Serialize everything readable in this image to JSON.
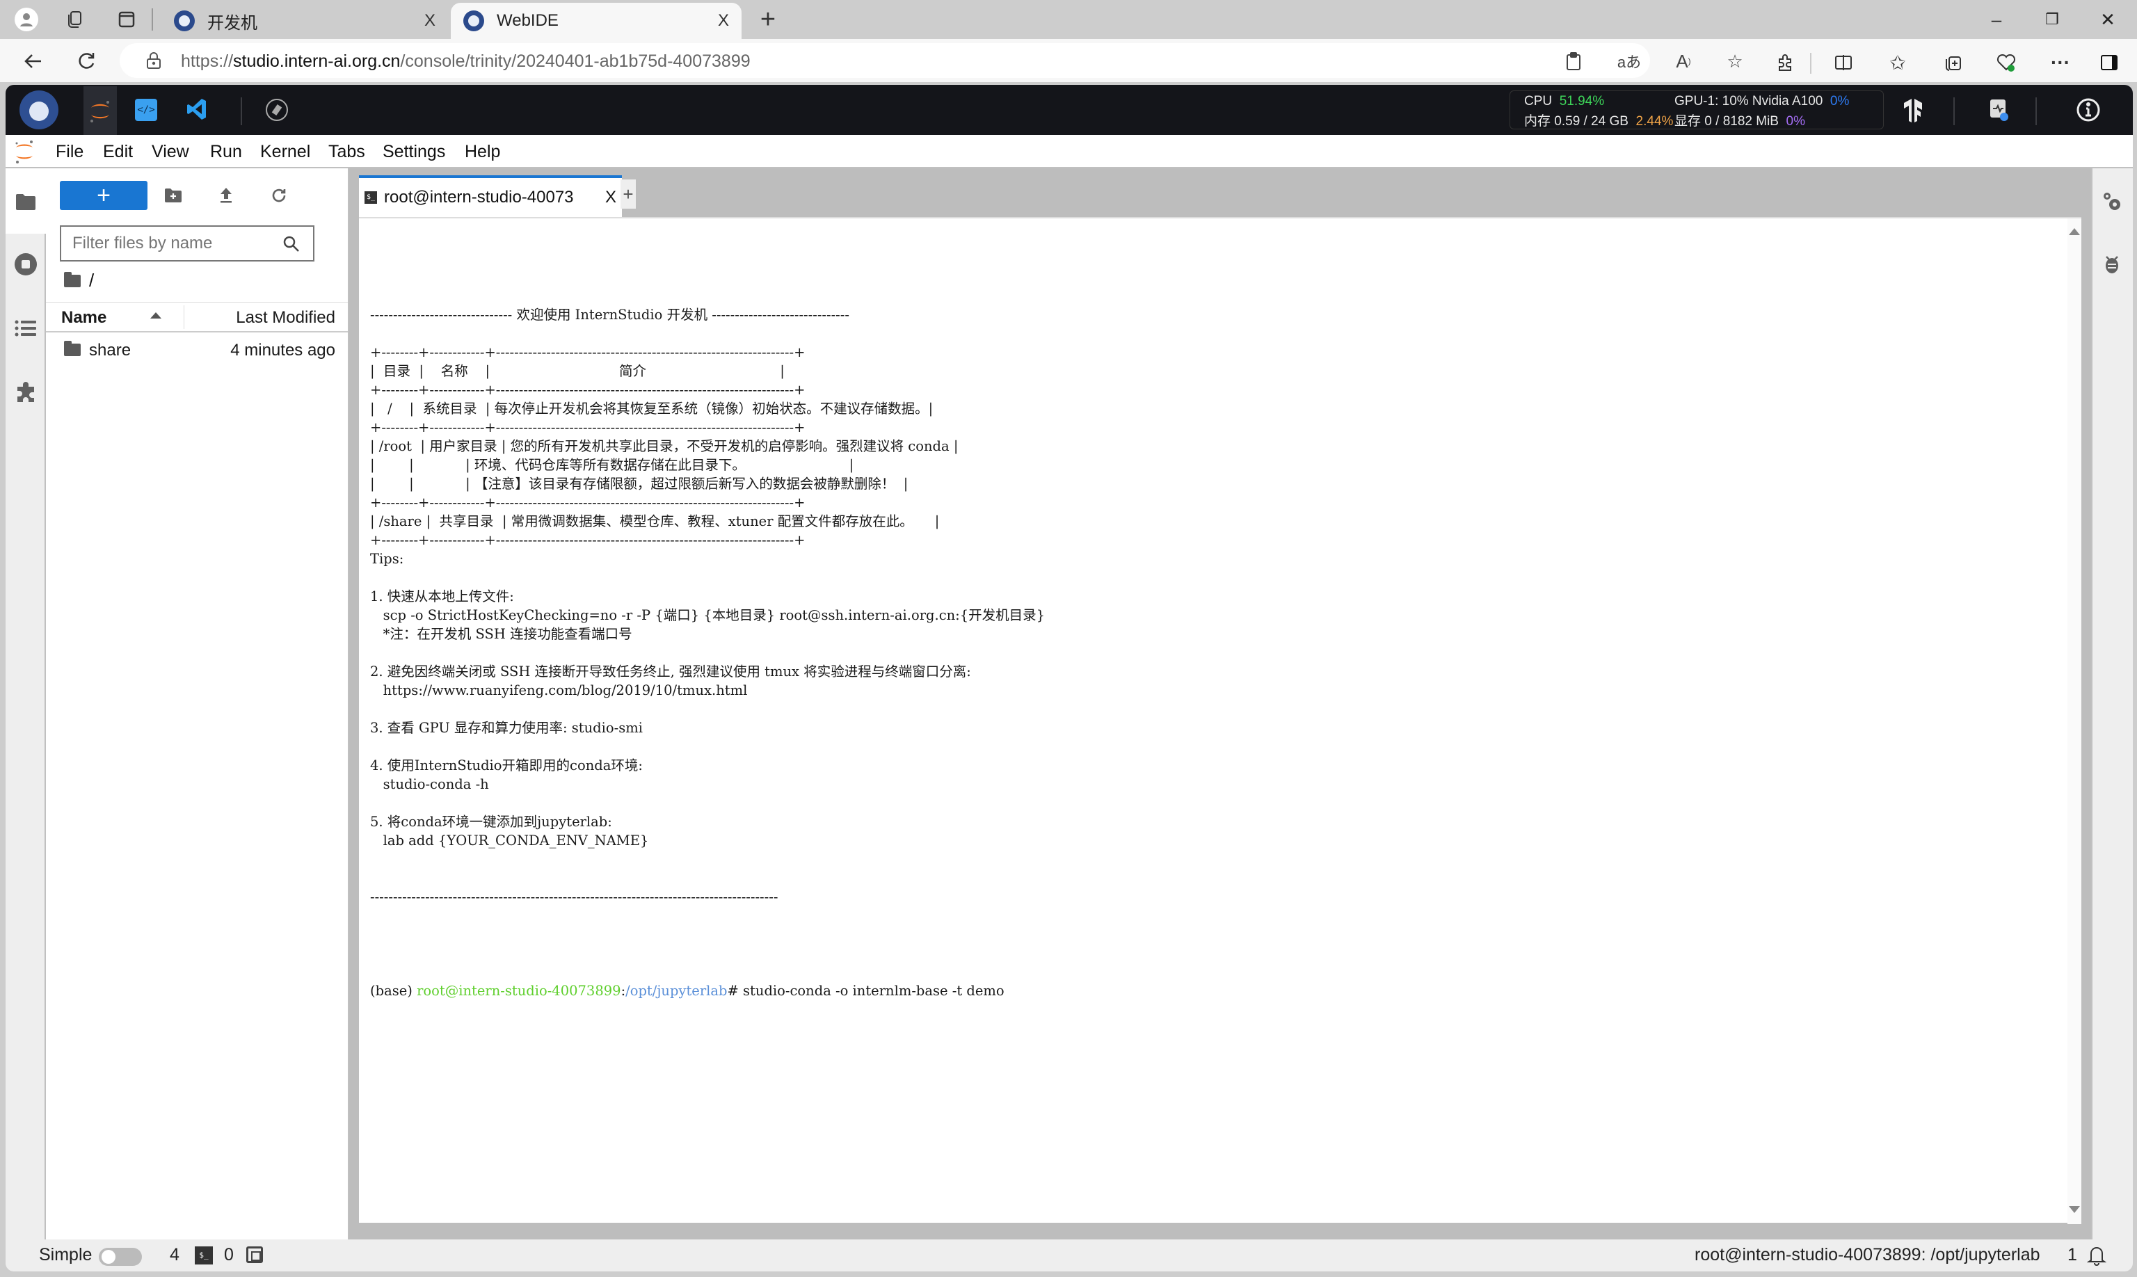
{
  "browser": {
    "tabs": [
      {
        "title": "开发机",
        "active": false
      },
      {
        "title": "WebIDE",
        "active": true
      }
    ],
    "url_host": "studio.intern-ai.org.cn",
    "url_scheme": "https://",
    "url_path": "/console/trinity/20240401-ab1b75d-40073899",
    "icons": {
      "profile": "profile-icon",
      "workspaces": "workspaces-icon",
      "tab_actions": "vertical-tabs-icon",
      "new_tab": "plus-icon",
      "minimize": "minimize-icon",
      "restore": "restore-icon",
      "close": "close-icon"
    },
    "new_tab_label": "+",
    "close_label": "X",
    "min_label": "–",
    "restore_label": "❐",
    "winclose_label": "✕"
  },
  "app_header": {
    "code_label": "</>",
    "vscode_label": "❮",
    "stats": {
      "cpu_label": "CPU",
      "cpu_value": "51.94%",
      "mem_label": "内存",
      "mem_value": "0.59 / 24 GB",
      "mem_pct": "2.44%",
      "gpu_label": "GPU-1: 10% Nvidia A100",
      "gpu_pct": "0%",
      "vram_label": "显存",
      "vram_value": "0 / 8182 MiB",
      "vram_pct": "0%"
    },
    "colors": {
      "cpu": "#3ed65a",
      "mem": "#f0a347",
      "gpu": "#2e7cf5",
      "vram": "#a56ef5"
    }
  },
  "menubar": {
    "items": [
      "File",
      "Edit",
      "View",
      "Run",
      "Kernel",
      "Tabs",
      "Settings",
      "Help"
    ]
  },
  "file_browser": {
    "new_label": "+",
    "filter_placeholder": "Filter files by name",
    "breadcrumb": "/",
    "columns": {
      "name": "Name",
      "modified": "Last Modified"
    },
    "files": [
      {
        "name": "share",
        "type": "folder",
        "modified": "4 minutes ago"
      }
    ]
  },
  "doc_tab": {
    "title": "root@intern-studio-40073",
    "close_label": "X",
    "add_label": "+"
  },
  "terminal": {
    "lines": [
      "",
      "------------------------------- 欢迎使用 InternStudio 开发机 ------------------------------",
      "",
      "+--------+------------+-----------------------------------------------------------------+",
      "|  目录  |    名称    |                              简介                               |",
      "+--------+------------+-----------------------------------------------------------------+",
      "|   /    |  系统目录  | 每次停止开发机会将其恢复至系统（镜像）初始状态。不建议存储数据。|",
      "+--------+------------+-----------------------------------------------------------------+",
      "| /root  | 用户家目录 | 您的所有开发机共享此目录，不受开发机的启停影响。强烈建议将 conda |",
      "|        |            | 环境、代码仓库等所有数据存储在此目录下。                        |",
      "|        |            | 【注意】该目录有存储限额，超过限额后新写入的数据会被静默删除！  |",
      "+--------+------------+-----------------------------------------------------------------+",
      "| /share |  共享目录  | 常用微调数据集、模型仓库、教程、xtuner 配置文件都存放在此。     |",
      "+--------+------------+-----------------------------------------------------------------+",
      "Tips:",
      "",
      "1. 快速从本地上传文件:",
      "   scp -o StrictHostKeyChecking=no -r -P {端口} {本地目录} root@ssh.intern-ai.org.cn:{开发机目录}",
      "   *注：在开发机 SSH 连接功能查看端口号",
      "",
      "2. 避免因终端关闭或 SSH 连接断开导致任务终止, 强烈建议使用 tmux 将实验进程与终端窗口分离:",
      "   https://www.ruanyifeng.com/blog/2019/10/tmux.html",
      "",
      "3. 查看 GPU 显存和算力使用率: studio-smi",
      "",
      "4. 使用InternStudio开箱即用的conda环境:",
      "   studio-conda -h",
      "",
      "5. 将conda环境一键添加到jupyterlab:",
      "   lab add {YOUR_CONDA_ENV_NAME}",
      "",
      "",
      "-----------------------------------------------------------------------------------------",
      "",
      ""
    ],
    "prompt": {
      "env": "(base) ",
      "user_host": "root@intern-studio-40073899",
      "sep": ":",
      "cwd": "/opt/jupyterlab",
      "hash": "# ",
      "command": "studio-conda -o internlm-base -t demo"
    },
    "colors": {
      "user_host": "#5fcf2d",
      "cwd": "#5a8fd8"
    }
  },
  "status_bar": {
    "mode_label": "Simple",
    "simple_mode_on": false,
    "kernels_count": "4",
    "terminals_count": "0",
    "path": "root@intern-studio-40073899: /opt/jupyterlab",
    "notifications": "1"
  }
}
